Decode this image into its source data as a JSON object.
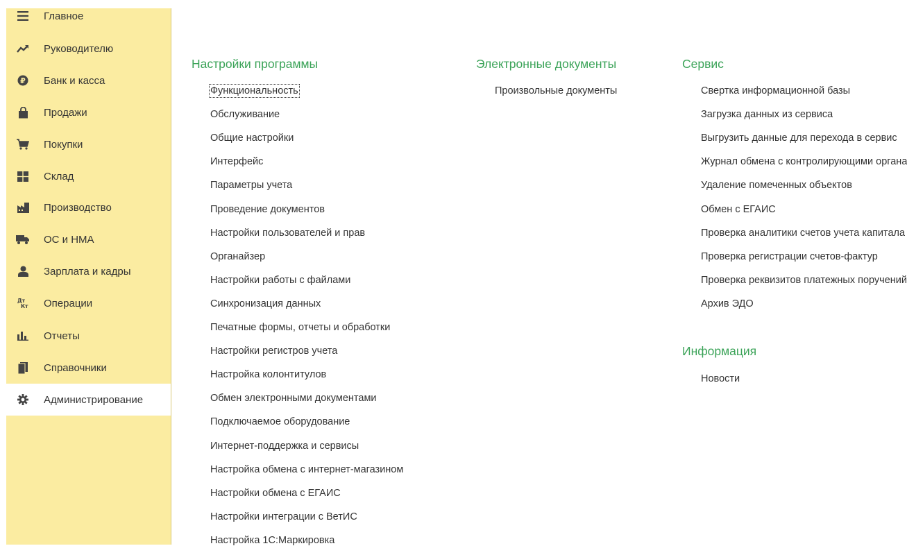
{
  "sidebar": {
    "items": [
      {
        "label": "Главное",
        "icon": "menu-lines-icon"
      },
      {
        "label": "Руководителю",
        "icon": "trend-icon"
      },
      {
        "label": "Банк и касса",
        "icon": "ruble-coin-icon"
      },
      {
        "label": "Продажи",
        "icon": "shopping-bag-icon"
      },
      {
        "label": "Покупки",
        "icon": "cart-icon"
      },
      {
        "label": "Склад",
        "icon": "warehouse-icon"
      },
      {
        "label": "Производство",
        "icon": "factory-icon"
      },
      {
        "label": "ОС и НМА",
        "icon": "truck-icon"
      },
      {
        "label": "Зарплата и кадры",
        "icon": "person-icon"
      },
      {
        "label": "Операции",
        "icon": "debit-credit-icon",
        "icon_text": "Дт\nКт"
      },
      {
        "label": "Отчеты",
        "icon": "bar-chart-icon"
      },
      {
        "label": "Справочники",
        "icon": "books-icon"
      },
      {
        "label": "Администрирование",
        "icon": "gear-icon",
        "active": true
      }
    ]
  },
  "columns": {
    "settings": {
      "title": "Настройки программы",
      "items": [
        "Функциональность",
        "Обслуживание",
        "Общие настройки",
        "Интерфейс",
        "Параметры учета",
        "Проведение документов",
        "Настройки пользователей и прав",
        "Органайзер",
        "Настройки работы с файлами",
        "Синхронизация данных",
        "Печатные формы, отчеты и обработки",
        "Настройки регистров учета",
        "Настройка колонтитулов",
        "Обмен электронными документами",
        "Подключаемое оборудование",
        "Интернет-поддержка и сервисы",
        "Настройка обмена с интернет-магазином",
        "Настройки обмена с ЕГАИС",
        "Настройки интеграции с ВетИС",
        "Настройка 1С:Маркировка"
      ]
    },
    "edocs": {
      "title": "Электронные документы",
      "items": [
        "Произвольные документы"
      ]
    },
    "service": {
      "title": "Сервис",
      "items": [
        "Свертка информационной базы",
        "Загрузка данных из сервиса",
        "Выгрузить данные для перехода в сервис",
        "Журнал обмена с контролирующими органами",
        "Удаление помеченных объектов",
        "Обмен с ЕГАИС",
        "Проверка аналитики счетов учета капитала",
        "Проверка регистрации счетов-фактур",
        "Проверка реквизитов платежных поручений",
        "Архив ЭДО"
      ]
    },
    "info": {
      "title": "Информация",
      "items": [
        "Новости"
      ]
    }
  },
  "colors": {
    "sidebar_bg": "#fbeca1",
    "section_title": "#3ba358",
    "text": "#333333"
  }
}
